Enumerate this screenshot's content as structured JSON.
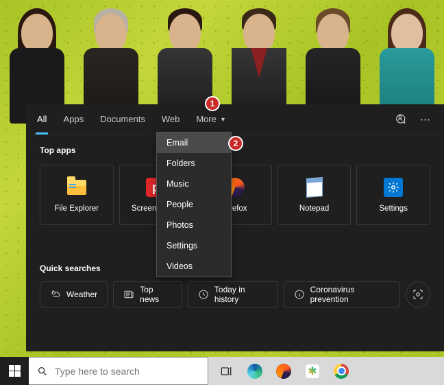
{
  "tabs": {
    "all": "All",
    "apps": "Apps",
    "documents": "Documents",
    "web": "Web",
    "more": "More"
  },
  "more_menu": {
    "items": [
      "Email",
      "Folders",
      "Music",
      "People",
      "Photos",
      "Settings",
      "Videos"
    ]
  },
  "sections": {
    "top_apps_title": "Top apps",
    "quick_searches_title": "Quick searches"
  },
  "top_apps": [
    {
      "id": "file-explorer",
      "label": "File Explorer"
    },
    {
      "id": "screenpresso",
      "label": "Screenpresso"
    },
    {
      "id": "firefox",
      "label": "Firefox"
    },
    {
      "id": "notepad",
      "label": "Notepad"
    },
    {
      "id": "settings",
      "label": "Settings"
    }
  ],
  "quick_searches": [
    {
      "id": "weather",
      "label": "Weather"
    },
    {
      "id": "top-news",
      "label": "Top news"
    },
    {
      "id": "today-history",
      "label": "Today in history"
    },
    {
      "id": "coronavirus",
      "label": "Coronavirus prevention"
    }
  ],
  "search": {
    "placeholder": "Type here to search"
  },
  "callouts": {
    "one": "1",
    "two": "2"
  }
}
